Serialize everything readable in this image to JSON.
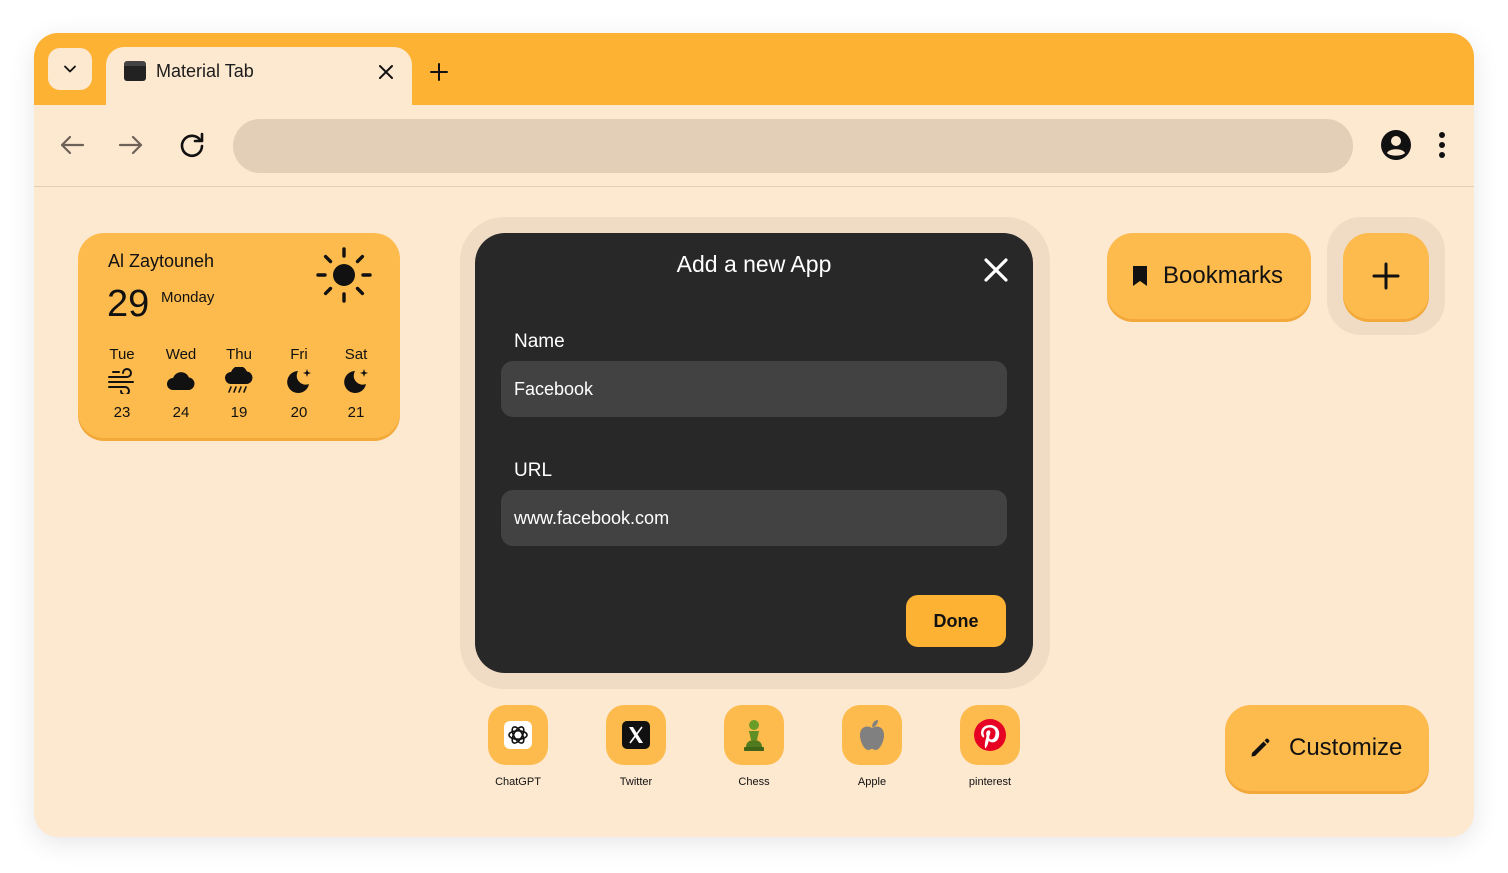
{
  "tab": {
    "title": "Material Tab"
  },
  "weather": {
    "location": "Al Zaytouneh",
    "temperature": "29",
    "day": "Monday",
    "current_icon": "sun-icon",
    "forecast": [
      {
        "day": "Tue",
        "icon": "wind-icon",
        "temp": "23"
      },
      {
        "day": "Wed",
        "icon": "cloud-icon",
        "temp": "24"
      },
      {
        "day": "Thu",
        "icon": "rain-cloud-icon",
        "temp": "19"
      },
      {
        "day": "Fri",
        "icon": "moon-star-icon",
        "temp": "20"
      },
      {
        "day": "Sat",
        "icon": "moon-star-icon",
        "temp": "21"
      }
    ]
  },
  "modal": {
    "title": "Add a new App",
    "name_label": "Name",
    "name_value": "Facebook",
    "url_label": "URL",
    "url_value": "www.facebook.com",
    "done_label": "Done"
  },
  "bookmarks": {
    "label": "Bookmarks"
  },
  "customize": {
    "label": "Customize"
  },
  "shortcuts": [
    {
      "name": "ChatGPT",
      "icon": "chatgpt-icon"
    },
    {
      "name": "Twitter",
      "icon": "x-icon"
    },
    {
      "name": "Chess",
      "icon": "chess-pawn-icon"
    },
    {
      "name": "Apple",
      "icon": "apple-icon"
    },
    {
      "name": "pinterest",
      "icon": "pinterest-icon"
    }
  ],
  "colors": {
    "accent": "#fdb233",
    "surface": "#fde8d0",
    "modal": "#282828",
    "input": "#424242"
  }
}
